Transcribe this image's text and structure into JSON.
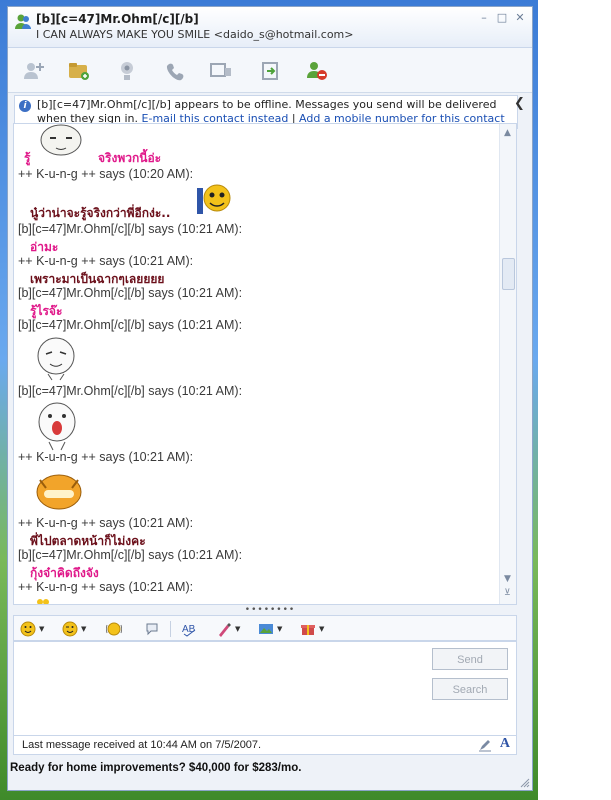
{
  "window": {
    "contact_name": "[b][c=47]Mr.Ohm[/c][/b]",
    "contact_status": "I CAN ALWAYS MAKE YOU SMILE <daido_s@hotmail.com>",
    "minimize": "–",
    "maximize": "□",
    "close": "✕"
  },
  "toolbar": {
    "icons": [
      "invite-icon",
      "send-files-icon",
      "webcam-icon",
      "call-icon",
      "activities-icon",
      "games-icon",
      "block-icon"
    ]
  },
  "infobar": {
    "text": "[b][c=47]Mr.Ohm[/c][/b] appears to be offline. Messages you send will be delivered when they sign in.",
    "link_email": "E-mail this contact instead",
    "separator": "|",
    "link_mobile": "Add a mobile number for this contact"
  },
  "conversation": {
    "lines": [
      {
        "text": "รู้",
        "color": "#e0198a"
      },
      {
        "text": "จริงพวกนี้อ่ะ",
        "color": "#e0198a"
      },
      {
        "text": "++ K-u-n-g ++ says (10:20 AM):"
      },
      {
        "text": "นู๋ว่าน่าจะรู้จริงกว่าพี่อีกง่ะ..",
        "color": "#6b0f1a"
      },
      {
        "text": "[b][c=47]Mr.Ohm[/c][/b] says (10:21 AM):"
      },
      {
        "text": "อ่ามะ",
        "color": "#e0198a"
      },
      {
        "text": "++ K-u-n-g ++ says (10:21 AM):"
      },
      {
        "text": "เพราะมาเป็นฉากๆเลยยยย",
        "color": "#6b0f1a"
      },
      {
        "text": "[b][c=47]Mr.Ohm[/c][/b] says (10:21 AM):"
      },
      {
        "text": "รู้ไรจ๊ะ",
        "color": "#e0198a"
      },
      {
        "text": "[b][c=47]Mr.Ohm[/c][/b] says (10:21 AM):"
      },
      {
        "text": "[b][c=47]Mr.Ohm[/c][/b] says (10:21 AM):"
      },
      {
        "text": "++ K-u-n-g ++ says (10:21 AM):"
      },
      {
        "text": "++ K-u-n-g ++ says (10:21 AM):"
      },
      {
        "text": "พี่ไปตลาดหน้าก็ไม่งคะ",
        "color": "#6b0f1a"
      },
      {
        "text": "[b][c=47]Mr.Ohm[/c][/b] says (10:21 AM):"
      },
      {
        "text": "กุ้งจ๋าคิดถึงจัง",
        "color": "#e0198a"
      },
      {
        "text": "++ K-u-n-g ++ says (10:21 AM):"
      }
    ]
  },
  "format_toolbar": {
    "icons": [
      "emoticon-icon",
      "wink-icon",
      "nudge-icon",
      "voice-clip-icon",
      "spell-check-icon",
      "background-icon",
      "display-picture-icon",
      "gift-icon"
    ]
  },
  "compose": {
    "value": "",
    "send_label": "Send",
    "search_label": "Search"
  },
  "status": {
    "last_message": "Last message received at 10:44 AM on 7/5/2007."
  },
  "ad": {
    "text": "Ready for home improvements? $40,000 for $283/mo."
  },
  "colors": {
    "accent": "#1a4fb4",
    "pink_text": "#e0198a",
    "maroon_text": "#6b0f1a"
  }
}
